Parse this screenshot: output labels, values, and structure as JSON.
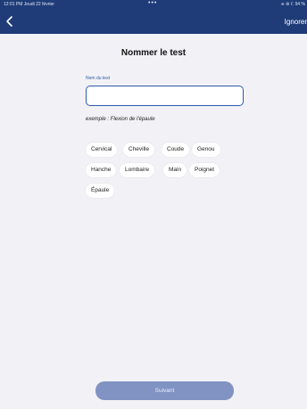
{
  "status_bar": {
    "time_date": "12:01 PM  Jeudi 22 février",
    "dots": "•••",
    "right": "⌯ ⊛ ℂ 94 %"
  },
  "nav": {
    "back_icon": "chevron-left-icon",
    "skip_label": "Ignorer"
  },
  "page": {
    "title": "Nommer le test"
  },
  "form": {
    "field_label": "Nom du test",
    "input_value": "",
    "input_placeholder": "",
    "example": "exemple : Flexion de l'épaule"
  },
  "chips": [
    [
      "Cervical",
      "Cheville",
      "Coude",
      "Genou"
    ],
    [
      "Hanche",
      "Lombaire",
      "Main",
      "Poignet"
    ],
    [
      "Épaule"
    ]
  ],
  "footer": {
    "next_label": "Suivant"
  },
  "colors": {
    "header": "#1f3c78",
    "accent": "#2f5aa8",
    "button_disabled": "#8193c3",
    "background": "#f2f2f6"
  }
}
